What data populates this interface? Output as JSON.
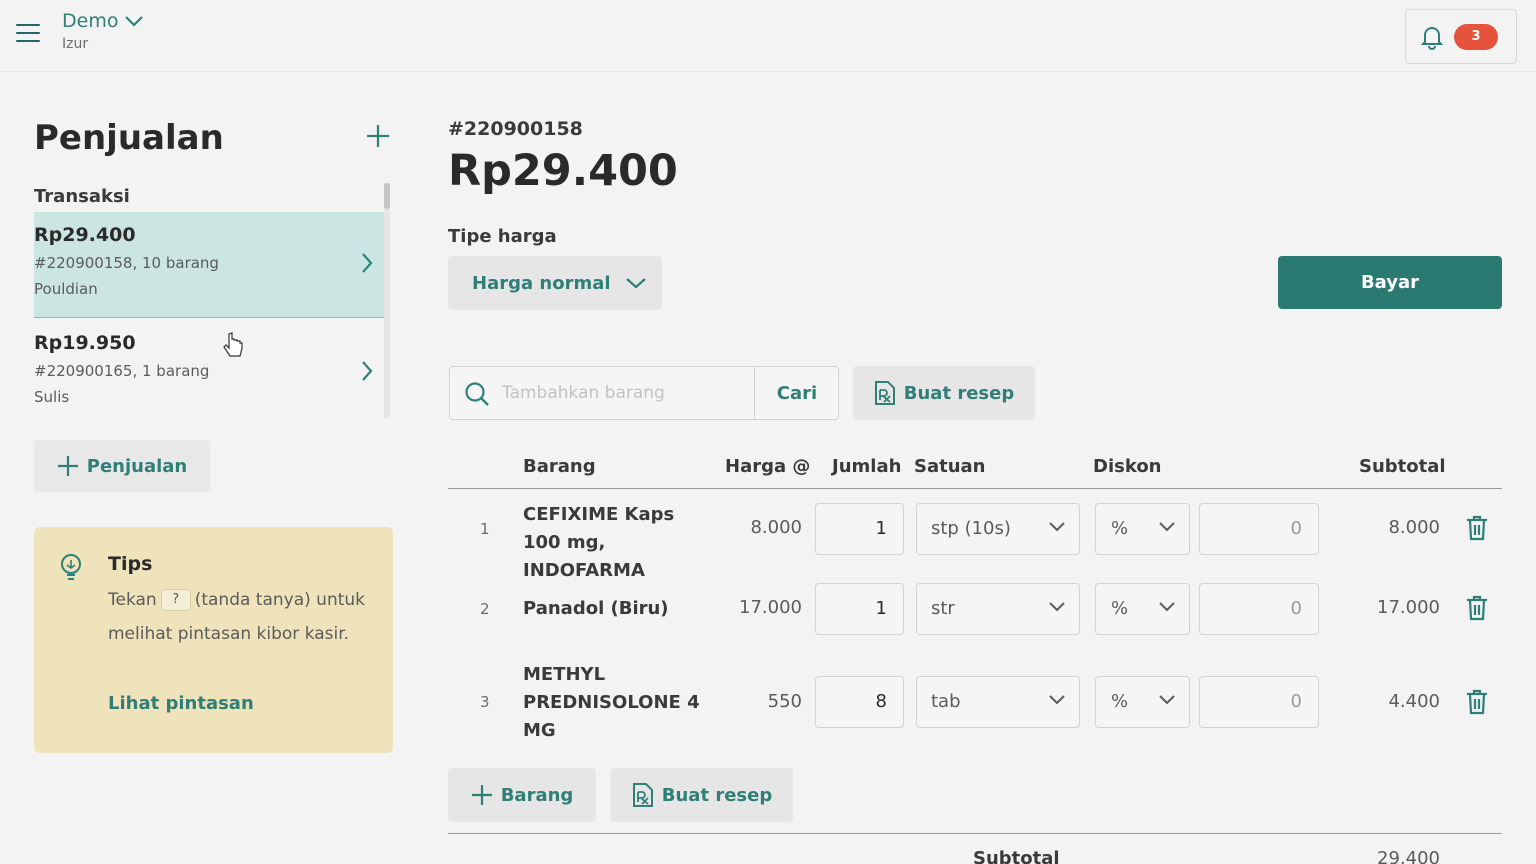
{
  "header": {
    "org_name": "Demo",
    "user_name": "Izur",
    "notif_count": "3"
  },
  "sidebar": {
    "title": "Penjualan",
    "section_label": "Transaksi",
    "transactions": [
      {
        "amount": "Rp29.400",
        "meta": "#220900158, 10 barang",
        "customer": "Pouldian",
        "active": true
      },
      {
        "amount": "Rp19.950",
        "meta": "#220900165, 1 barang",
        "customer": "Sulis",
        "active": false
      }
    ],
    "add_label": "Penjualan",
    "tips": {
      "title": "Tips",
      "text_before": "Tekan",
      "key": "?",
      "text_after": "(tanda tanya) untuk melihat pintasan kibor kasir.",
      "link": "Lihat pintasan"
    }
  },
  "main": {
    "invoice_no": "#220900158",
    "total": "Rp29.400",
    "price_type_label": "Tipe harga",
    "price_type_value": "Harga normal",
    "pay_label": "Bayar",
    "search_placeholder": "Tambahkan barang",
    "search_button": "Cari",
    "recipe_button": "Buat resep",
    "columns": {
      "barang": "Barang",
      "harga": "Harga @",
      "jumlah": "Jumlah",
      "satuan": "Satuan",
      "diskon": "Diskon",
      "subtotal": "Subtotal"
    },
    "rows": [
      {
        "no": "1",
        "name": "CEFIXIME Kaps 100 mg, INDOFARMA",
        "price": "8.000",
        "qty": "1",
        "unit": "stp (10s)",
        "disc_type": "%",
        "disc": "0",
        "subtotal": "8.000"
      },
      {
        "no": "2",
        "name": "Panadol (Biru)",
        "price": "17.000",
        "qty": "1",
        "unit": "str",
        "disc_type": "%",
        "disc": "0",
        "subtotal": "17.000"
      },
      {
        "no": "3",
        "name": "METHYL PREDNISOLONE 4 MG",
        "price": "550",
        "qty": "8",
        "unit": "tab",
        "disc_type": "%",
        "disc": "0",
        "subtotal": "4.400"
      }
    ],
    "add_item_label": "Barang",
    "recipe_button_2": "Buat resep",
    "subtotal_label": "Subtotal",
    "subtotal_value": "29.400"
  },
  "colors": {
    "accent": "#2f7f77",
    "primary_button": "#2a7a72",
    "active_row": "#cbe6e2",
    "tips_bg": "#efe3bc",
    "badge": "#e5533d"
  }
}
